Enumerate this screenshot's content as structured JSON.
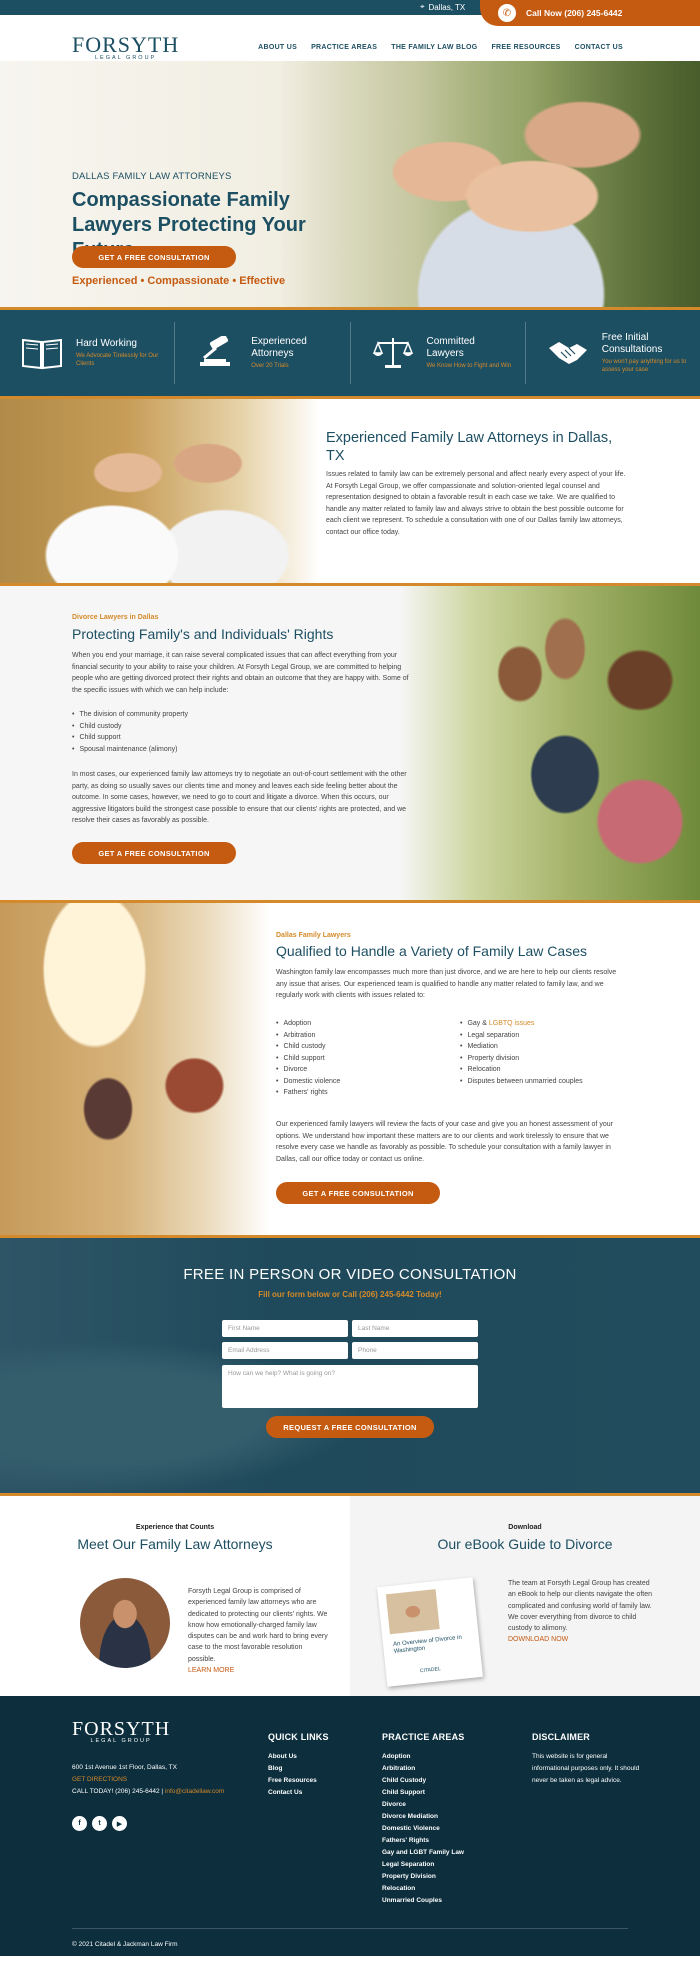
{
  "topbar": {
    "location": "Dallas, TX",
    "call_label": "Call Now (206) 245-6442"
  },
  "logo": {
    "name": "FORSYTH",
    "sub": "LEGAL GROUP"
  },
  "nav": [
    "ABOUT US",
    "PRACTICE AREAS",
    "THE FAMILY LAW BLOG",
    "FREE RESOURCES",
    "CONTACT US"
  ],
  "hero": {
    "kicker": "DALLAS FAMILY LAW ATTORNEYS",
    "title": "Compassionate Family Lawyers Protecting Your Future",
    "tagline": "Experienced • Compassionate • Effective",
    "cta": "GET A FREE CONSULTATION"
  },
  "features": [
    {
      "title": "Hard Working",
      "sub": "We Advocate Tirelessly for Our Clients",
      "icon": "book-icon"
    },
    {
      "title": "Experienced Attorneys",
      "sub": "Over 20 Trials",
      "icon": "gavel-icon"
    },
    {
      "title": "Committed Lawyers",
      "sub": "We Know How to Fight and Win",
      "icon": "scales-icon"
    },
    {
      "title": "Free Initial Consultations",
      "sub": "You won't pay anything for us to assess your case",
      "icon": "handshake-icon"
    }
  ],
  "intro": {
    "title": "Experienced Family Law Attorneys in Dallas, TX",
    "body": "Issues related to family law can be extremely personal and affect nearly every aspect of your life. At Forsyth Legal Group, we offer compassionate and solution-oriented legal counsel and representation designed to obtain a favorable result in each case we take. We are qualified to handle any matter related to family law and always strive to obtain the best possible outcome for each client we represent. To schedule a consultation with one of our Dallas family law attorneys, contact our office today."
  },
  "divorce": {
    "eyebrow": "Divorce Lawyers in Dallas",
    "title": "Protecting Family's and Individuals' Rights",
    "p1": "When you end your marriage, it can raise several complicated issues that can affect everything from your financial security to your ability to raise your children. At Forsyth Legal Group, we are committed to helping people who are getting divorced protect their rights and obtain an outcome that they are happy with. Some of the specific issues with which we can help include:",
    "items": [
      "The division of community property",
      "Child custody",
      "Child support",
      "Spousal maintenance (alimony)"
    ],
    "p2": "In most cases, our experienced family law attorneys try to negotiate an out-of-court settlement with the other party, as doing so usually saves our clients time and money and leaves each side feeling better about the outcome. In some cases, however, we need to go to court and litigate a divorce. When this occurs, our aggressive litigators build the strongest case possible to ensure that our clients' rights are protected, and we resolve their cases as favorably as possible.",
    "cta": "GET A FREE CONSULTATION"
  },
  "family": {
    "eyebrow": "Dallas Family Lawyers",
    "title": "Qualified to Handle a Variety of Family Law Cases",
    "p1": "Washington family law encompasses much more than just divorce, and we are here to help our clients resolve any issue that arises. Our experienced team is qualified to handle any matter related to family law, and we regularly work with clients with issues related to:",
    "col1": [
      "Adoption",
      "Arbitration",
      "Child custody",
      "Child support",
      "Divorce",
      "Domestic violence",
      "Fathers' rights"
    ],
    "col2_first_prefix": "Gay & ",
    "col2_first_link": "LGBTQ issues",
    "col2": [
      "Legal separation",
      "Mediation",
      "Property division",
      "Relocation",
      "Disputes between unmarried couples"
    ],
    "p2": "Our experienced family lawyers will review the facts of your case and give you an honest assessment of your options. We understand how important these matters are to our clients and work tirelessly to ensure that we resolve every case we handle as favorably as possible. To schedule your consultation with a family lawyer in Dallas, call our office today or contact us online.",
    "cta": "GET A FREE CONSULTATION"
  },
  "consult": {
    "title": "FREE IN PERSON OR VIDEO CONSULTATION",
    "sub": "Fill our form below or Call (206) 245-6442 Today!",
    "first": "First Name",
    "last": "Last Name",
    "email": "Email Address",
    "phone": "Phone",
    "message": "How can we help? What is going on?",
    "submit": "REQUEST A FREE CONSULTATION"
  },
  "meet": {
    "small": "Experience that Counts",
    "title": "Meet Our Family Law Attorneys",
    "body": "Forsyth Legal Group is comprised of experienced family law attorneys who are dedicated to protecting our clients' rights. We know how emotionally-charged family law disputes can be and work hard to bring every case to the most favorable resolution possible.",
    "more": "LEARN MORE"
  },
  "ebook": {
    "small": "Download",
    "title": "Our eBook Guide to Divorce",
    "cover_title": "An Overview of Divorce in Washington",
    "cover_brand": "CITADEL",
    "body": "The team at Forsyth Legal Group has created an eBook to help our clients navigate the often complicated and confusing world of family law. We cover everything from divorce to child custody to alimony.",
    "more": "DOWNLOAD NOW"
  },
  "footer": {
    "address": "600 1st Avenue 1st Floor, Dallas, TX",
    "directions": "GET DIRECTIONS",
    "call": "CALL TODAY! (206) 245-6442",
    "sep": "|",
    "email": "info@citadellaw.com",
    "social": [
      "f",
      "t",
      "▶"
    ],
    "quick_title": "QUICK LINKS",
    "quick": [
      "About Us",
      "Blog",
      "Free Resources",
      "Contact Us"
    ],
    "practice_title": "PRACTICE AREAS",
    "practice": [
      "Adoption",
      "Arbitration",
      "Child Custody",
      "Child Support",
      "Divorce",
      "Divorce Mediation",
      "Domestic Violence",
      "Fathers' Rights",
      "Gay and LGBT Family Law",
      "Legal Separation",
      "Property Division",
      "Relocation",
      "Unmarried Couples"
    ],
    "disclaimer_title": "DISCLAIMER",
    "disclaimer": "This website is for general informational purposes only. It should never be taken as legal advice.",
    "copyright": "© 2021 Citadel & Jackman Law Firm"
  },
  "colors": {
    "primary": "#1d4f63",
    "accent": "#c55a11",
    "gold": "#d48a2a",
    "footer": "#0c2e3d"
  }
}
